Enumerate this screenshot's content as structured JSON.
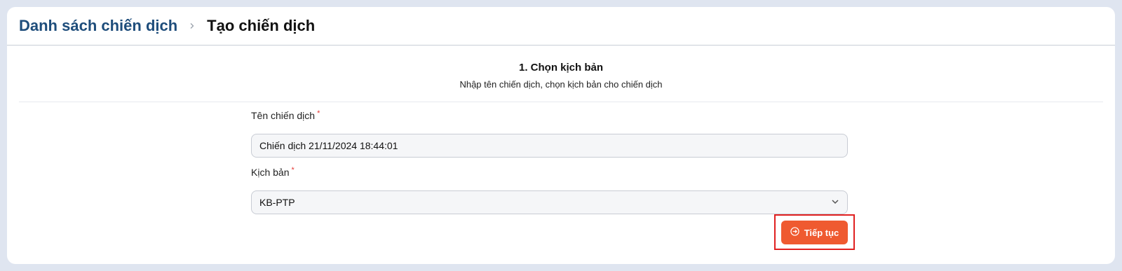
{
  "breadcrumb": {
    "parent": "Danh sách chiến dịch",
    "current": "Tạo chiến dịch"
  },
  "step": {
    "title": "1. Chọn kịch bản",
    "subtitle": "Nhập tên chiến dịch, chọn kịch bản cho chiến dịch"
  },
  "form": {
    "name_label": "Tên chiến dịch",
    "name_value": "Chiến dịch 21/11/2024 18:44:01",
    "script_label": "Kịch bản",
    "script_selected": "KB-PTP",
    "required_mark": "*"
  },
  "actions": {
    "continue_label": "Tiếp tục"
  },
  "colors": {
    "accent": "#ef5a30",
    "breadcrumb_link": "#1e4d7b",
    "highlight": "#e02020"
  }
}
